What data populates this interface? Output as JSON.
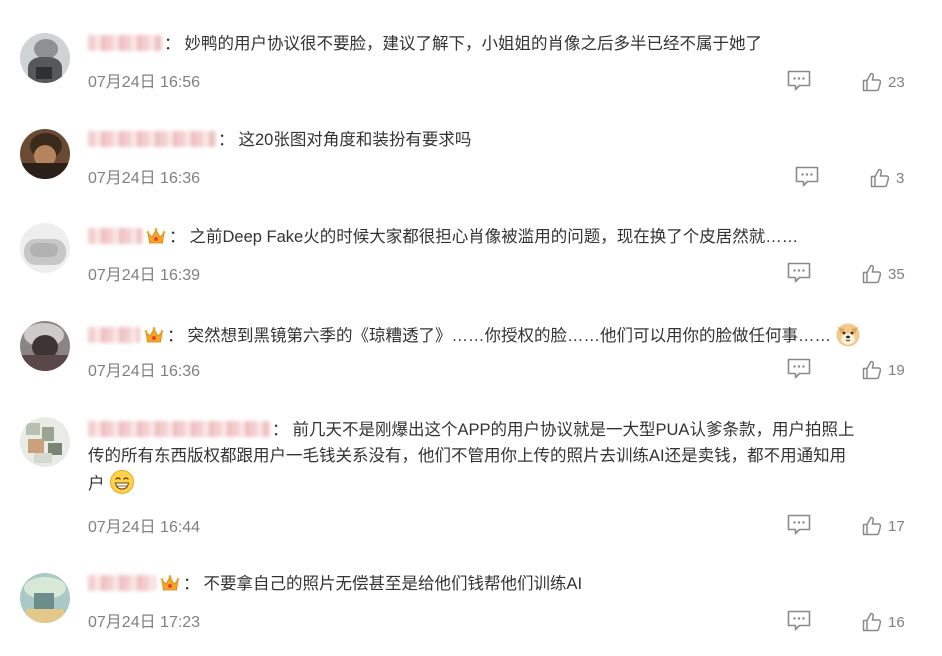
{
  "comments": [
    {
      "text": "妙鸭的用户协议很不要脸，建议了解下，小姐姐的肖像之后多半已经不属于她了",
      "time": "07月24日 16:56",
      "likes": "23",
      "crown": false
    },
    {
      "text": "这20张图对角度和装扮有要求吗",
      "time": "07月24日 16:36",
      "likes": "3",
      "crown": false
    },
    {
      "text": "之前Deep Fake火的时候大家都很担心肖像被滥用的问题，现在换了个皮居然就……",
      "time": "07月24日 16:39",
      "likes": "35",
      "crown": true
    },
    {
      "text": "突然想到黑镜第六季的《琼糟透了》……你授权的脸……他们可以用你的脸做任何事……",
      "time": "07月24日 16:36",
      "likes": "19",
      "crown": true,
      "emoji": "doge-emoji"
    },
    {
      "text_line1": "前几天不是刚爆出这个APP的用户协议就是一大型PUA认爹条款，用户拍照上",
      "text_line2": "传的所有东西版权都跟用户一毛钱关系没有，他们不管用你上传的照片去训练AI还是卖钱，都不用通知用",
      "text_line3": "户",
      "time": "07月24日 16:44",
      "likes": "17",
      "crown": false,
      "emoji": "grin-emoji"
    },
    {
      "text": "不要拿自己的照片无偿甚至是给他们钱帮他们训练AI",
      "time": "07月24日 17:23",
      "likes": "16",
      "crown": true
    }
  ],
  "separator": "：",
  "colors": {
    "text": "#333333",
    "meta": "#808080",
    "icon": "#8a8a8a",
    "crown": "#f5a623",
    "blurred_name": "#f3c9c9"
  }
}
